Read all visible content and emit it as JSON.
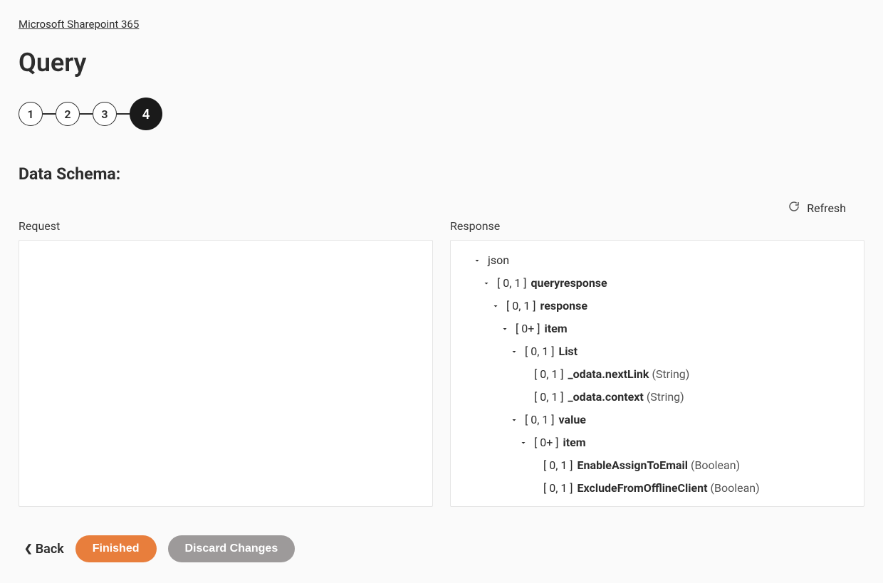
{
  "breadcrumb": {
    "parent": "Microsoft Sharepoint 365"
  },
  "page": {
    "title": "Query"
  },
  "stepper": {
    "steps": [
      "1",
      "2",
      "3",
      "4"
    ],
    "active_index": 3
  },
  "section": {
    "title": "Data Schema:"
  },
  "actions": {
    "refresh": "Refresh",
    "back": "Back",
    "finished": "Finished",
    "discard": "Discard Changes"
  },
  "panels": {
    "request_label": "Request",
    "response_label": "Response"
  },
  "tree": {
    "root_name": "json",
    "nodes": {
      "queryresponse": {
        "card": "[ 0, 1 ]",
        "name": "queryresponse"
      },
      "response": {
        "card": "[ 0, 1 ]",
        "name": "response"
      },
      "item1": {
        "card": "[ 0+ ]",
        "name": "item"
      },
      "list": {
        "card": "[ 0, 1 ]",
        "name": "List"
      },
      "nextlink": {
        "card": "[ 0, 1 ]",
        "name": "_odata.nextLink",
        "type": "(String)"
      },
      "context": {
        "card": "[ 0, 1 ]",
        "name": "_odata.context",
        "type": "(String)"
      },
      "value": {
        "card": "[ 0, 1 ]",
        "name": "value"
      },
      "item2": {
        "card": "[ 0+ ]",
        "name": "item"
      },
      "enableassign": {
        "card": "[ 0, 1 ]",
        "name": "EnableAssignToEmail",
        "type": "(Boolean)"
      },
      "exclude": {
        "card": "[ 0, 1 ]",
        "name": "ExcludeFromOfflineClient",
        "type": "(Boolean)"
      }
    }
  }
}
